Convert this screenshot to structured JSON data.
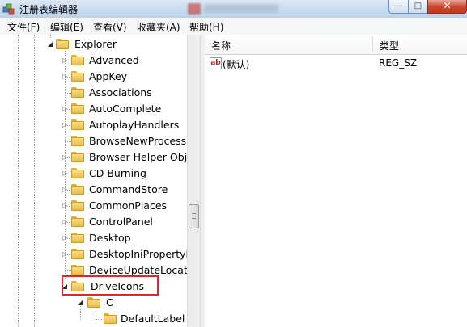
{
  "window": {
    "title": "注册表编辑器",
    "buttons": {
      "minimize": "—",
      "maximize": "□",
      "close": "✕"
    }
  },
  "menu": [
    {
      "label": "文件(F)"
    },
    {
      "label": "编辑(E)"
    },
    {
      "label": "查看(V)"
    },
    {
      "label": "收藏夹(A)"
    },
    {
      "label": "帮助(H)"
    }
  ],
  "tree": {
    "root": {
      "label": "Explorer",
      "expander": "◢"
    },
    "children": [
      {
        "label": "Advanced",
        "expander": "▷"
      },
      {
        "label": "AppKey",
        "expander": "▷"
      },
      {
        "label": "Associations",
        "expander": ""
      },
      {
        "label": "AutoComplete",
        "expander": "▷"
      },
      {
        "label": "AutoplayHandlers",
        "expander": "▷"
      },
      {
        "label": "BrowseNewProcess",
        "expander": ""
      },
      {
        "label": "Browser Helper Obje",
        "expander": "▷"
      },
      {
        "label": "CD Burning",
        "expander": "▷"
      },
      {
        "label": "CommandStore",
        "expander": "▷"
      },
      {
        "label": "CommonPlaces",
        "expander": "▷"
      },
      {
        "label": "ControlPanel",
        "expander": "▷"
      },
      {
        "label": "Desktop",
        "expander": "▷"
      },
      {
        "label": "DesktopIniPropertyM",
        "expander": "▷"
      },
      {
        "label": "DeviceUpdateLocatio",
        "expander": ""
      },
      {
        "label": "DriveIcons",
        "expander": "◢",
        "selected": true
      }
    ],
    "drive_children": [
      {
        "label": "C",
        "expander": "◢"
      }
    ],
    "c_children": [
      {
        "label": "DefaultLabel",
        "expander": ""
      }
    ]
  },
  "values_pane": {
    "columns": [
      {
        "label": "名称"
      },
      {
        "label": "类型"
      }
    ],
    "rows": [
      {
        "icon": "string-value-icon",
        "icon_text": "ab",
        "name": "(默认)",
        "type": "REG_SZ"
      }
    ]
  }
}
